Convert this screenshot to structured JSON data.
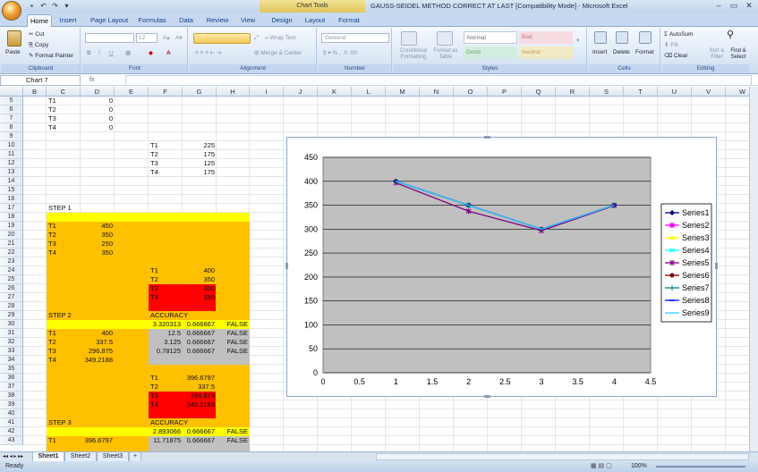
{
  "window": {
    "title": "GAUSS-SEIDEL METHOD CORRECT AT LAST  [Compatibility Mode] - Microsoft Excel",
    "context_tab": "Chart Tools"
  },
  "tabs": [
    "Home",
    "Insert",
    "Page Layout",
    "Formulas",
    "Data",
    "Review",
    "View",
    "Design",
    "Layout",
    "Format"
  ],
  "ribbon": {
    "clipboard": {
      "label": "Clipboard",
      "paste": "Paste",
      "cut": "Cut",
      "copy": "Copy",
      "format_painter": "Format Painter"
    },
    "font": {
      "label": "Font",
      "size": "12"
    },
    "alignment": {
      "label": "Alignment",
      "wrap_text": "Wrap Text",
      "merge_center": "Merge & Center"
    },
    "number": {
      "label": "Number",
      "format": "General"
    },
    "styles": {
      "label": "Styles",
      "conditional": "Conditional Formatting",
      "format_table": "Format as Table",
      "normal": "Normal",
      "bad": "Bad",
      "good": "Good",
      "neutral": "Neutral"
    },
    "cells": {
      "label": "Cells",
      "insert": "Insert",
      "delete": "Delete",
      "format": "Format"
    },
    "editing": {
      "label": "Editing",
      "autosum": "AutoSum",
      "fill": "Fill",
      "clear": "Clear",
      "sort_filter": "Sort & Filter",
      "find_select": "Find & Select"
    }
  },
  "name_box": "Chart 7",
  "fx": "fx",
  "columns": [
    "B",
    "C",
    "D",
    "E",
    "F",
    "G",
    "H",
    "I",
    "J",
    "K",
    "L",
    "M",
    "N",
    "O",
    "P",
    "Q",
    "R",
    "S",
    "T",
    "U",
    "V",
    "W"
  ],
  "rows": [
    "5",
    "6",
    "7",
    "8",
    "9",
    "10",
    "11",
    "12",
    "13",
    "14",
    "15",
    "16",
    "17",
    "18",
    "19",
    "20",
    "21",
    "22",
    "23",
    "24",
    "25",
    "26",
    "27",
    "28",
    "29",
    "30",
    "31",
    "32",
    "33",
    "34",
    "35",
    "36",
    "37",
    "38",
    "39",
    "40",
    "41",
    "42",
    "43"
  ],
  "cells": {
    "c5": "T1",
    "d5": "0",
    "c6": "T2",
    "d6": "0",
    "c7": "T3",
    "d7": "0",
    "c8": "T4",
    "d8": "0",
    "f10": "T1",
    "g10": "225",
    "f11": "T2",
    "g11": "175",
    "f12": "T3",
    "g12": "125",
    "f13": "T4",
    "g13": "175",
    "c17": "STEP 1",
    "c19": "T1",
    "d19": "450",
    "c20": "T2",
    "d20": "350",
    "c21": "T3",
    "d21": "250",
    "c22": "T4",
    "d22": "350",
    "f24": "T1",
    "g24": "400",
    "f25": "T2",
    "g25": "350",
    "f26": "T3",
    "g26": "300",
    "f27": "T4",
    "g27": "350",
    "c29": "STEP 2",
    "f29": "ACCURACY",
    "f30": "3.320313",
    "g30": "0.666667",
    "h30": "FALSE",
    "c31": "T1",
    "d31": "400",
    "f31": "12.5",
    "g31": "0.666667",
    "h31": "FALSE",
    "c32": "T2",
    "d32": "337.5",
    "f32": "3.125",
    "g32": "0.666667",
    "h32": "FALSE",
    "c33": "T3",
    "d33": "296.875",
    "f33": "0.78125",
    "g33": "0.666667",
    "h33": "FALSE",
    "c34": "T4",
    "d34": "349.2188",
    "f36": "T1",
    "g36": "396.6797",
    "f37": "T2",
    "g37": "337.5",
    "f38": "T3",
    "g38": "296.875",
    "f39": "T4",
    "g39": "349.2188",
    "c41": "STEP 3",
    "f41": "ACCURACY",
    "f42": "2.893066",
    "g42": "0.666667",
    "h42": "FALSE",
    "c43": "T1",
    "d43": "396.6797",
    "f43": "11.71875",
    "g43": "0.666667",
    "h43": "FALSE"
  },
  "colors": {
    "yellow": "#ffff00",
    "orange": "#ffc000",
    "red": "#ff0000",
    "gray": "#c0c0c0",
    "plot_bg": "#c0c0c0"
  },
  "sheets": [
    "Sheet1",
    "Sheet2",
    "Sheet3"
  ],
  "status": {
    "ready": "Ready",
    "zoom": "100%"
  },
  "chart_data": {
    "type": "line",
    "xlim": [
      0,
      4.5
    ],
    "ylim": [
      0,
      450
    ],
    "xticks": [
      "0",
      "0.5",
      "1",
      "1.5",
      "2",
      "2.5",
      "3",
      "3.5",
      "4",
      "4.5"
    ],
    "yticks": [
      "0",
      "50",
      "100",
      "150",
      "200",
      "250",
      "300",
      "350",
      "400",
      "450"
    ],
    "grid": true,
    "legend": "right",
    "series": [
      {
        "name": "Series1",
        "color": "#000080",
        "marker": "diamond",
        "x": [
          1,
          2,
          3,
          4
        ],
        "y": [
          400,
          350,
          300,
          350
        ]
      },
      {
        "name": "Series2",
        "color": "#ff00ff",
        "marker": "square",
        "x": [
          1,
          2,
          3,
          4
        ],
        "y": [
          400,
          350,
          300,
          350
        ]
      },
      {
        "name": "Series3",
        "color": "#ffff00",
        "marker": "triangle",
        "x": [
          1,
          2,
          3,
          4
        ],
        "y": [
          400,
          350,
          300,
          350
        ]
      },
      {
        "name": "Series4",
        "color": "#00ffff",
        "marker": "x",
        "x": [
          1,
          2,
          3,
          4
        ],
        "y": [
          400,
          350,
          300,
          350
        ]
      },
      {
        "name": "Series5",
        "color": "#800080",
        "marker": "star",
        "x": [
          1,
          2,
          3,
          4
        ],
        "y": [
          396.6797,
          337.5,
          296.875,
          349.2188
        ]
      },
      {
        "name": "Series6",
        "color": "#800000",
        "marker": "circle",
        "x": [
          1,
          2,
          3,
          4
        ],
        "y": [
          400,
          350,
          300,
          350
        ]
      },
      {
        "name": "Series7",
        "color": "#008080",
        "marker": "plus",
        "x": [
          1,
          2,
          3,
          4
        ],
        "y": [
          400,
          350,
          300,
          350
        ]
      },
      {
        "name": "Series8",
        "color": "#0000ff",
        "marker": "dash",
        "x": [
          1,
          2,
          3,
          4
        ],
        "y": [
          400,
          350,
          300,
          350
        ]
      },
      {
        "name": "Series9",
        "color": "#33ccff",
        "marker": "none",
        "x": [
          1,
          2,
          3,
          4
        ],
        "y": [
          400,
          350,
          300,
          350
        ]
      }
    ]
  }
}
